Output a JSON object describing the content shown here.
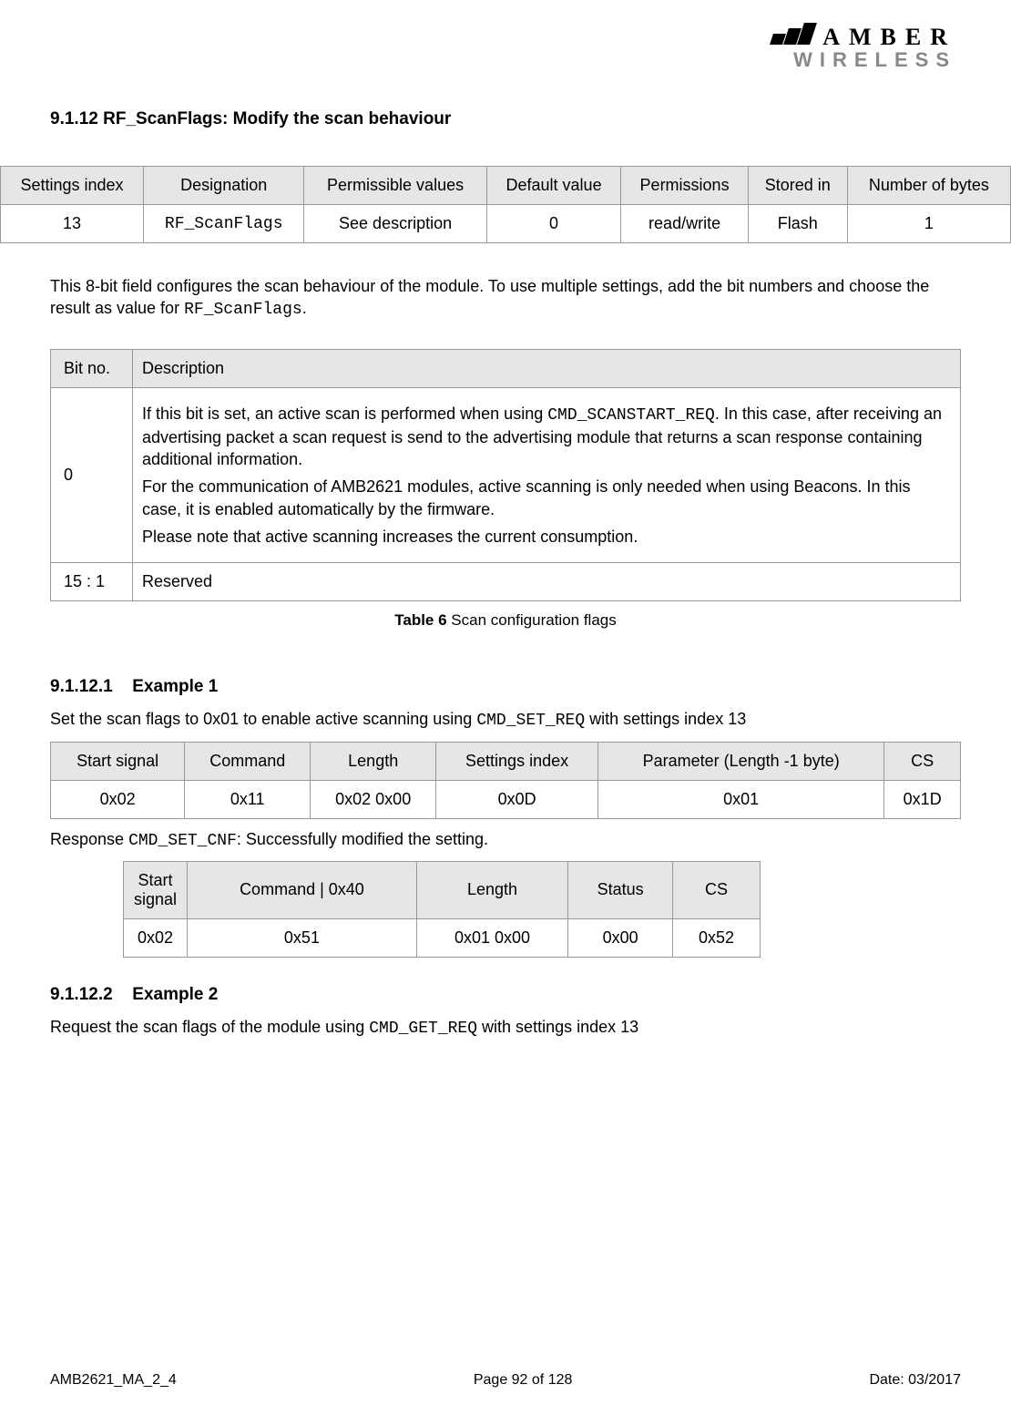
{
  "logo": {
    "top": "AMBER",
    "bottom": "WIRELESS"
  },
  "section": {
    "num": "9.1.12",
    "title": "RF_ScanFlags: Modify the scan behaviour"
  },
  "settings_table": {
    "headers": [
      "Settings index",
      "Designation",
      "Permissible values",
      "Default value",
      "Permissions",
      "Stored in",
      "Number of bytes"
    ],
    "row": [
      "13",
      "RF_ScanFlags",
      "See description",
      "0",
      "read/write",
      "Flash",
      "1"
    ]
  },
  "intro_p1a": "This 8-bit field configures the scan behaviour of the module. To use multiple settings, add the bit numbers and choose the result as value for ",
  "intro_p1b": "RF_ScanFlags",
  "intro_p1c": ".",
  "bit_table": {
    "headers": [
      "Bit no.",
      "Description"
    ],
    "rows": [
      {
        "bit": "0",
        "p1a": "If this bit is set, an active scan is performed when using ",
        "p1b": "CMD_SCANSTART_REQ",
        "p1c": ". In this case, after receiving an advertising packet a scan request is send to the advertising module that returns a scan response containing additional information.",
        "p2": "For the communication of AMB2621 modules, active scanning is only needed when using Beacons. In this case, it is enabled automatically by the firmware.",
        "p3": "Please note that active scanning increases the current consumption."
      },
      {
        "bit": "15 : 1",
        "p1": "Reserved"
      }
    ]
  },
  "caption1_bold": "Table 6",
  "caption1_rest": " Scan configuration flags",
  "ex1": {
    "num": "9.1.12.1",
    "title": "Example 1",
    "p_a": "Set the scan flags to 0x01 to enable active scanning using  ",
    "p_b": "CMD_SET_REQ",
    "p_c": " with settings index 13",
    "headers": [
      "Start signal",
      "Command",
      "Length",
      "Settings index",
      "Parameter (Length -1 byte)",
      "CS"
    ],
    "row": [
      "0x02",
      "0x11",
      "0x02 0x00",
      "0x0D",
      "0x01",
      "0x1D"
    ],
    "resp_a": "Response ",
    "resp_b": "CMD_SET_CNF",
    "resp_c": ": Successfully modified the setting.",
    "resp_headers": [
      "Start signal",
      "Command | 0x40",
      "Length",
      "Status",
      "CS"
    ],
    "resp_row": [
      "0x02",
      "0x51",
      "0x01 0x00",
      "0x00",
      "0x52"
    ]
  },
  "ex2": {
    "num": "9.1.12.2",
    "title": "Example 2",
    "p_a": "Request the scan flags of the module using  ",
    "p_b": "CMD_GET_REQ",
    "p_c": " with settings index 13"
  },
  "footer": {
    "left": "AMB2621_MA_2_4",
    "center": "Page 92 of 128",
    "right": "Date: 03/2017"
  }
}
